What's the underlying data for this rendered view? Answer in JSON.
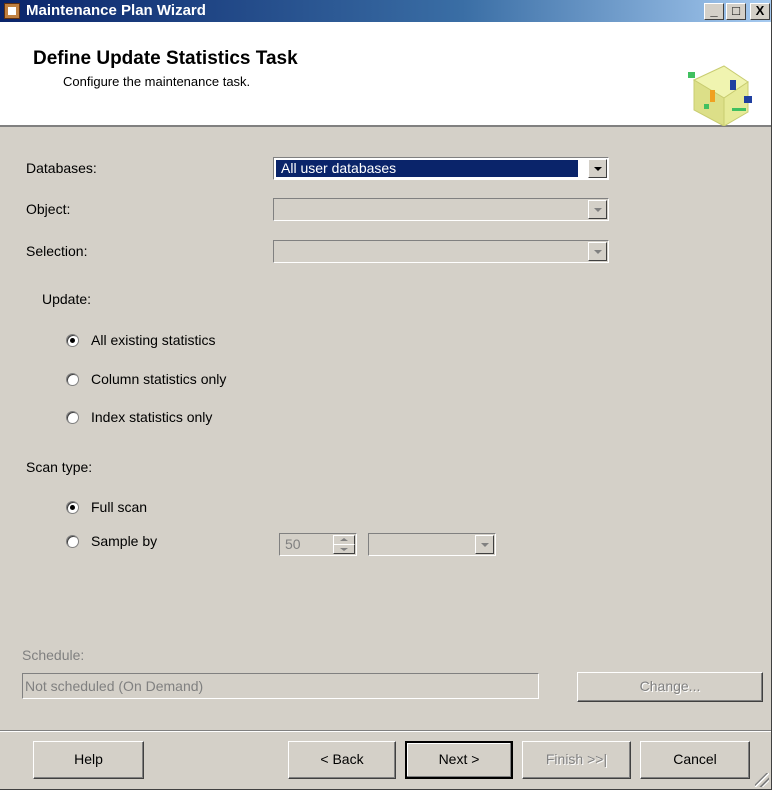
{
  "window": {
    "title": "Maintenance Plan Wizard",
    "controls": [
      "_",
      "□",
      "X"
    ]
  },
  "header": {
    "title": "Define Update Statistics Task",
    "subtitle": "Configure the maintenance task.",
    "art_icon": "wizard-graphic-icon"
  },
  "form": {
    "databases_label": "Databases:",
    "databases_value": "All user databases",
    "object_label": "Object:",
    "object_value": "",
    "selection_label": "Selection:",
    "selection_value": ""
  },
  "update": {
    "label": "Update:",
    "options": [
      "All existing statistics",
      "Column statistics only",
      "Index statistics only"
    ],
    "selected": "All existing statistics"
  },
  "scan": {
    "label": "Scan type:",
    "options": [
      "Full scan",
      "Sample by"
    ],
    "selected": "Full scan",
    "sample_value": "50",
    "sample_unit": ""
  },
  "schedule": {
    "label": "Schedule:",
    "value": "Not scheduled (On Demand)",
    "change_button": "Change..."
  },
  "buttons": {
    "help": "Help",
    "back": "< Back",
    "next": "Next >",
    "finish": "Finish >>|",
    "cancel": "Cancel"
  },
  "colors": {
    "face": "#d4d0c8",
    "selection": "#0a246a",
    "title_start": "#0a246a"
  }
}
